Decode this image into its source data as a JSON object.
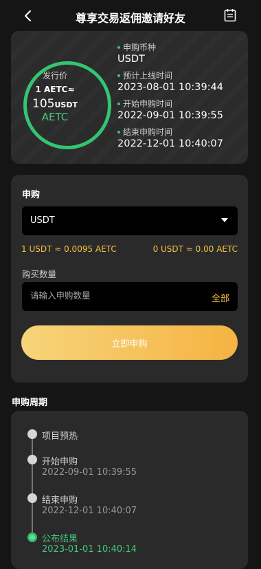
{
  "header": {
    "title": "尊享交易返佣邀请好友",
    "back_icon": "chevron-left-icon",
    "calendar_icon": "calendar-icon"
  },
  "summary": {
    "ring_label": "发行价",
    "rate_line1": "1 AETC≈",
    "rate_amount": "105",
    "rate_unit": "USDT",
    "token": "AETC",
    "accent_color": "#33c572",
    "fields": [
      {
        "label": "申购币种",
        "value": "USDT"
      },
      {
        "label": "预计上线时间",
        "value": "2023-08-01 10:39:44"
      },
      {
        "label": "开始申购时间",
        "value": "2022-09-01 10:39:55"
      },
      {
        "label": "结束申购时间",
        "value": "2022-12-01 10:40:07"
      }
    ]
  },
  "subscribe": {
    "title": "申购",
    "currency_selected": "USDT",
    "rate_left": "1 USDT ≈ 0.0095 AETC",
    "rate_right": "0 USDT ≈ 0.00 AETC",
    "qty_label": "购买数量",
    "qty_placeholder": "请输入申购数量",
    "all_label": "全部",
    "submit_label": "立即申购",
    "highlight_color": "#f5c244"
  },
  "period": {
    "title": "申购周期",
    "steps": [
      {
        "label": "项目预热",
        "time": ""
      },
      {
        "label": "开始申购",
        "time": "2022-09-01 10:39:55"
      },
      {
        "label": "结束申购",
        "time": "2022-12-01 10:40:07"
      },
      {
        "label": "公布结果",
        "time": "2023-01-01 10:40:14"
      }
    ]
  }
}
